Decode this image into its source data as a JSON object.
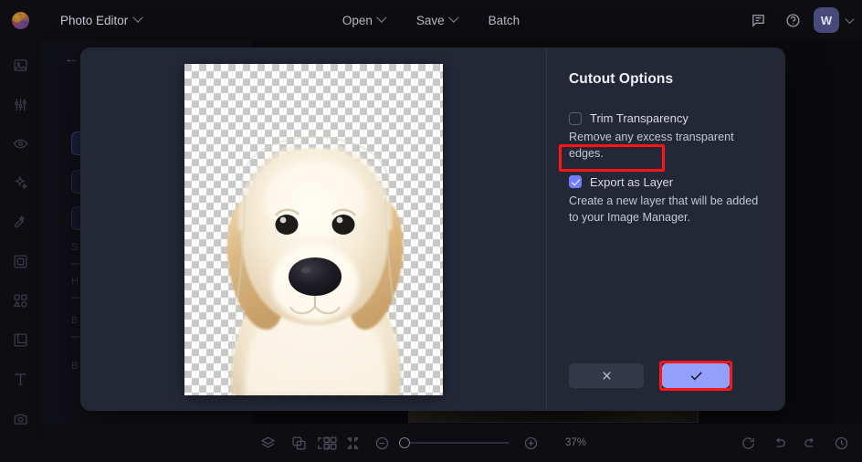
{
  "app": {
    "logo_icon": "color-wheel-logo-icon",
    "name": "Photo Editor",
    "name_chevron_icon": "chevron-down-icon"
  },
  "topbar": {
    "menus": [
      {
        "label": "Open",
        "icon": "chevron-down-icon",
        "has_chevron": true
      },
      {
        "label": "Save",
        "icon": "chevron-down-icon",
        "has_chevron": true
      },
      {
        "label": "Batch",
        "has_chevron": false
      }
    ],
    "right_tools": [
      {
        "name": "feedback-icon",
        "glyph": "comment"
      },
      {
        "name": "help-icon",
        "glyph": "question-circle"
      }
    ],
    "avatar": {
      "initial": "W",
      "chevron_icon": "chevron-down-icon",
      "color": "#4a4a7a"
    }
  },
  "sidebar": {
    "items": [
      {
        "name": "sidebar-item-image",
        "icon": "image-icon"
      },
      {
        "name": "sidebar-item-adjust",
        "icon": "sliders-icon"
      },
      {
        "name": "sidebar-item-effects",
        "icon": "eye-icon"
      },
      {
        "name": "sidebar-item-retouch",
        "icon": "sparkles-icon"
      },
      {
        "name": "sidebar-item-cutout",
        "icon": "magic-wand-icon"
      },
      {
        "name": "sidebar-item-frame",
        "icon": "frame-icon"
      },
      {
        "name": "sidebar-item-shapes",
        "icon": "shapes-icon"
      },
      {
        "name": "sidebar-item-crop",
        "icon": "crop-icon"
      },
      {
        "name": "sidebar-item-text",
        "icon": "text-icon"
      },
      {
        "name": "sidebar-item-camera",
        "icon": "camera-icon"
      }
    ]
  },
  "background_panel": {
    "back_icon": "arrow-left-icon",
    "labels": [
      "S",
      "H",
      "B",
      "B"
    ]
  },
  "modal": {
    "title": "Cutout Options",
    "preview": {
      "name": "cutout-preview",
      "alt": "golden retriever puppy cutout on transparent checkerboard"
    },
    "options": [
      {
        "id": "trim-transparency",
        "label": "Trim Transparency",
        "description": "Remove any excess transparent edges.",
        "checked": false,
        "highlighted": false
      },
      {
        "id": "export-as-layer",
        "label": "Export as Layer",
        "description": "Create a new layer that will be added to your Image Manager.",
        "checked": true,
        "highlighted": true
      }
    ],
    "actions": {
      "cancel_icon": "close-x-icon",
      "confirm_icon": "checkmark-icon",
      "confirm_highlighted": true
    },
    "colors": {
      "accent": "#6f7dfb",
      "confirm_button": "#93a0fb",
      "highlight": "#ff1515",
      "panel_bg": "#242736"
    }
  },
  "bottombar": {
    "left_tools": [
      {
        "name": "layers-icon"
      },
      {
        "name": "link-image-icon"
      },
      {
        "name": "grid-icon"
      }
    ],
    "center_tools": [
      {
        "name": "fit-to-screen-icon"
      },
      {
        "name": "actual-size-icon"
      },
      {
        "name": "zoom-out-icon"
      }
    ],
    "zoom_level": "37%",
    "zoom_in_icon": "zoom-in-icon",
    "right_tools": [
      {
        "name": "refresh-icon"
      },
      {
        "name": "undo-icon"
      },
      {
        "name": "redo-icon"
      },
      {
        "name": "history-icon"
      }
    ]
  }
}
